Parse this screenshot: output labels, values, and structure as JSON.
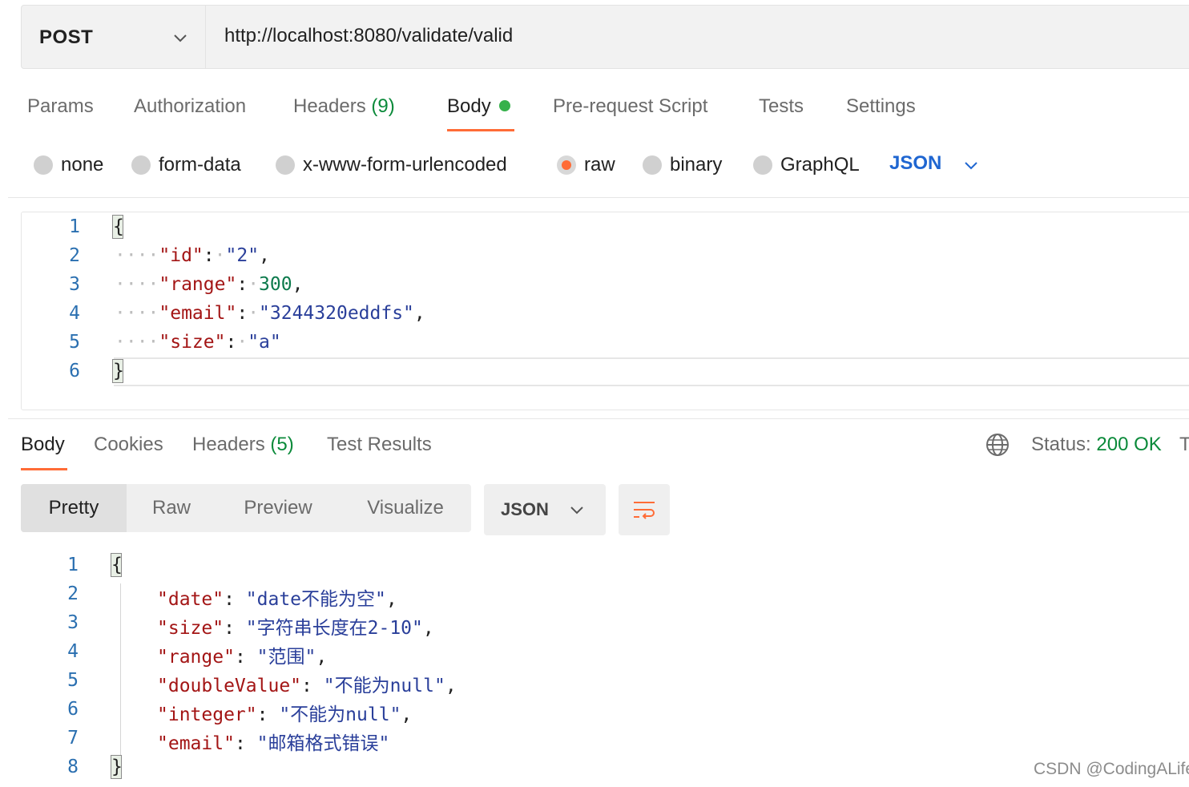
{
  "request": {
    "method": "POST",
    "url": "http://localhost:8080/validate/valid",
    "tabs": {
      "params": "Params",
      "authorization": "Authorization",
      "headers": "Headers",
      "headers_count": "(9)",
      "body": "Body",
      "prerequest": "Pre-request Script",
      "tests": "Tests",
      "settings": "Settings"
    },
    "body_modes": {
      "none": "none",
      "form_data": "form-data",
      "urlencoded": "x-www-form-urlencoded",
      "raw": "raw",
      "binary": "binary",
      "graphql": "GraphQL",
      "selected": "raw",
      "language": "JSON"
    },
    "editor": {
      "line_numbers": [
        "1",
        "2",
        "3",
        "4",
        "5",
        "6"
      ],
      "open_brace": "{",
      "close_brace": "}",
      "lines": [
        {
          "indent": "····",
          "key": "\"id\"",
          "colon": ":",
          "sp": "·",
          "value": "\"2\"",
          "trail": ","
        },
        {
          "indent": "····",
          "key": "\"range\"",
          "colon": ":",
          "sp": "·",
          "value": "300",
          "trail": ","
        },
        {
          "indent": "····",
          "key": "\"email\"",
          "colon": ":",
          "sp": "·",
          "value": "\"3244320eddfs\"",
          "trail": ","
        },
        {
          "indent": "····",
          "key": "\"size\"",
          "colon": ":",
          "sp": "·",
          "value": "\"a\"",
          "trail": ""
        }
      ]
    }
  },
  "response": {
    "tabs": {
      "body": "Body",
      "cookies": "Cookies",
      "headers": "Headers",
      "headers_count": "(5)",
      "test_results": "Test Results"
    },
    "status_label": "Status:",
    "status_value": "200 OK",
    "overflow_text": "T",
    "views": {
      "pretty": "Pretty",
      "raw": "Raw",
      "preview": "Preview",
      "visualize": "Visualize"
    },
    "format": "JSON",
    "body": {
      "line_numbers": [
        "1",
        "2",
        "3",
        "4",
        "5",
        "6",
        "7",
        "8"
      ],
      "open_brace": "{",
      "close_brace": "}",
      "lines": [
        {
          "key": "\"date\"",
          "colon": ": ",
          "value": "\"date不能为空\"",
          "trail": ","
        },
        {
          "key": "\"size\"",
          "colon": ": ",
          "value": "\"字符串长度在2-10\"",
          "trail": ","
        },
        {
          "key": "\"range\"",
          "colon": ": ",
          "value": "\"范围\"",
          "trail": ","
        },
        {
          "key": "\"doubleValue\"",
          "colon": ": ",
          "value": "\"不能为null\"",
          "trail": ","
        },
        {
          "key": "\"integer\"",
          "colon": ": ",
          "value": "\"不能为null\"",
          "trail": ","
        },
        {
          "key": "\"email\"",
          "colon": ": ",
          "value": "\"邮箱格式错误\"",
          "trail": ""
        }
      ]
    }
  },
  "watermark": "CSDN @CodingALife",
  "colors": {
    "accent": "#ff6c37",
    "link_blue": "#1f66d1",
    "success_green": "#0b8a3a",
    "key_red": "#a31515",
    "string_blue": "#2a3f9a"
  }
}
